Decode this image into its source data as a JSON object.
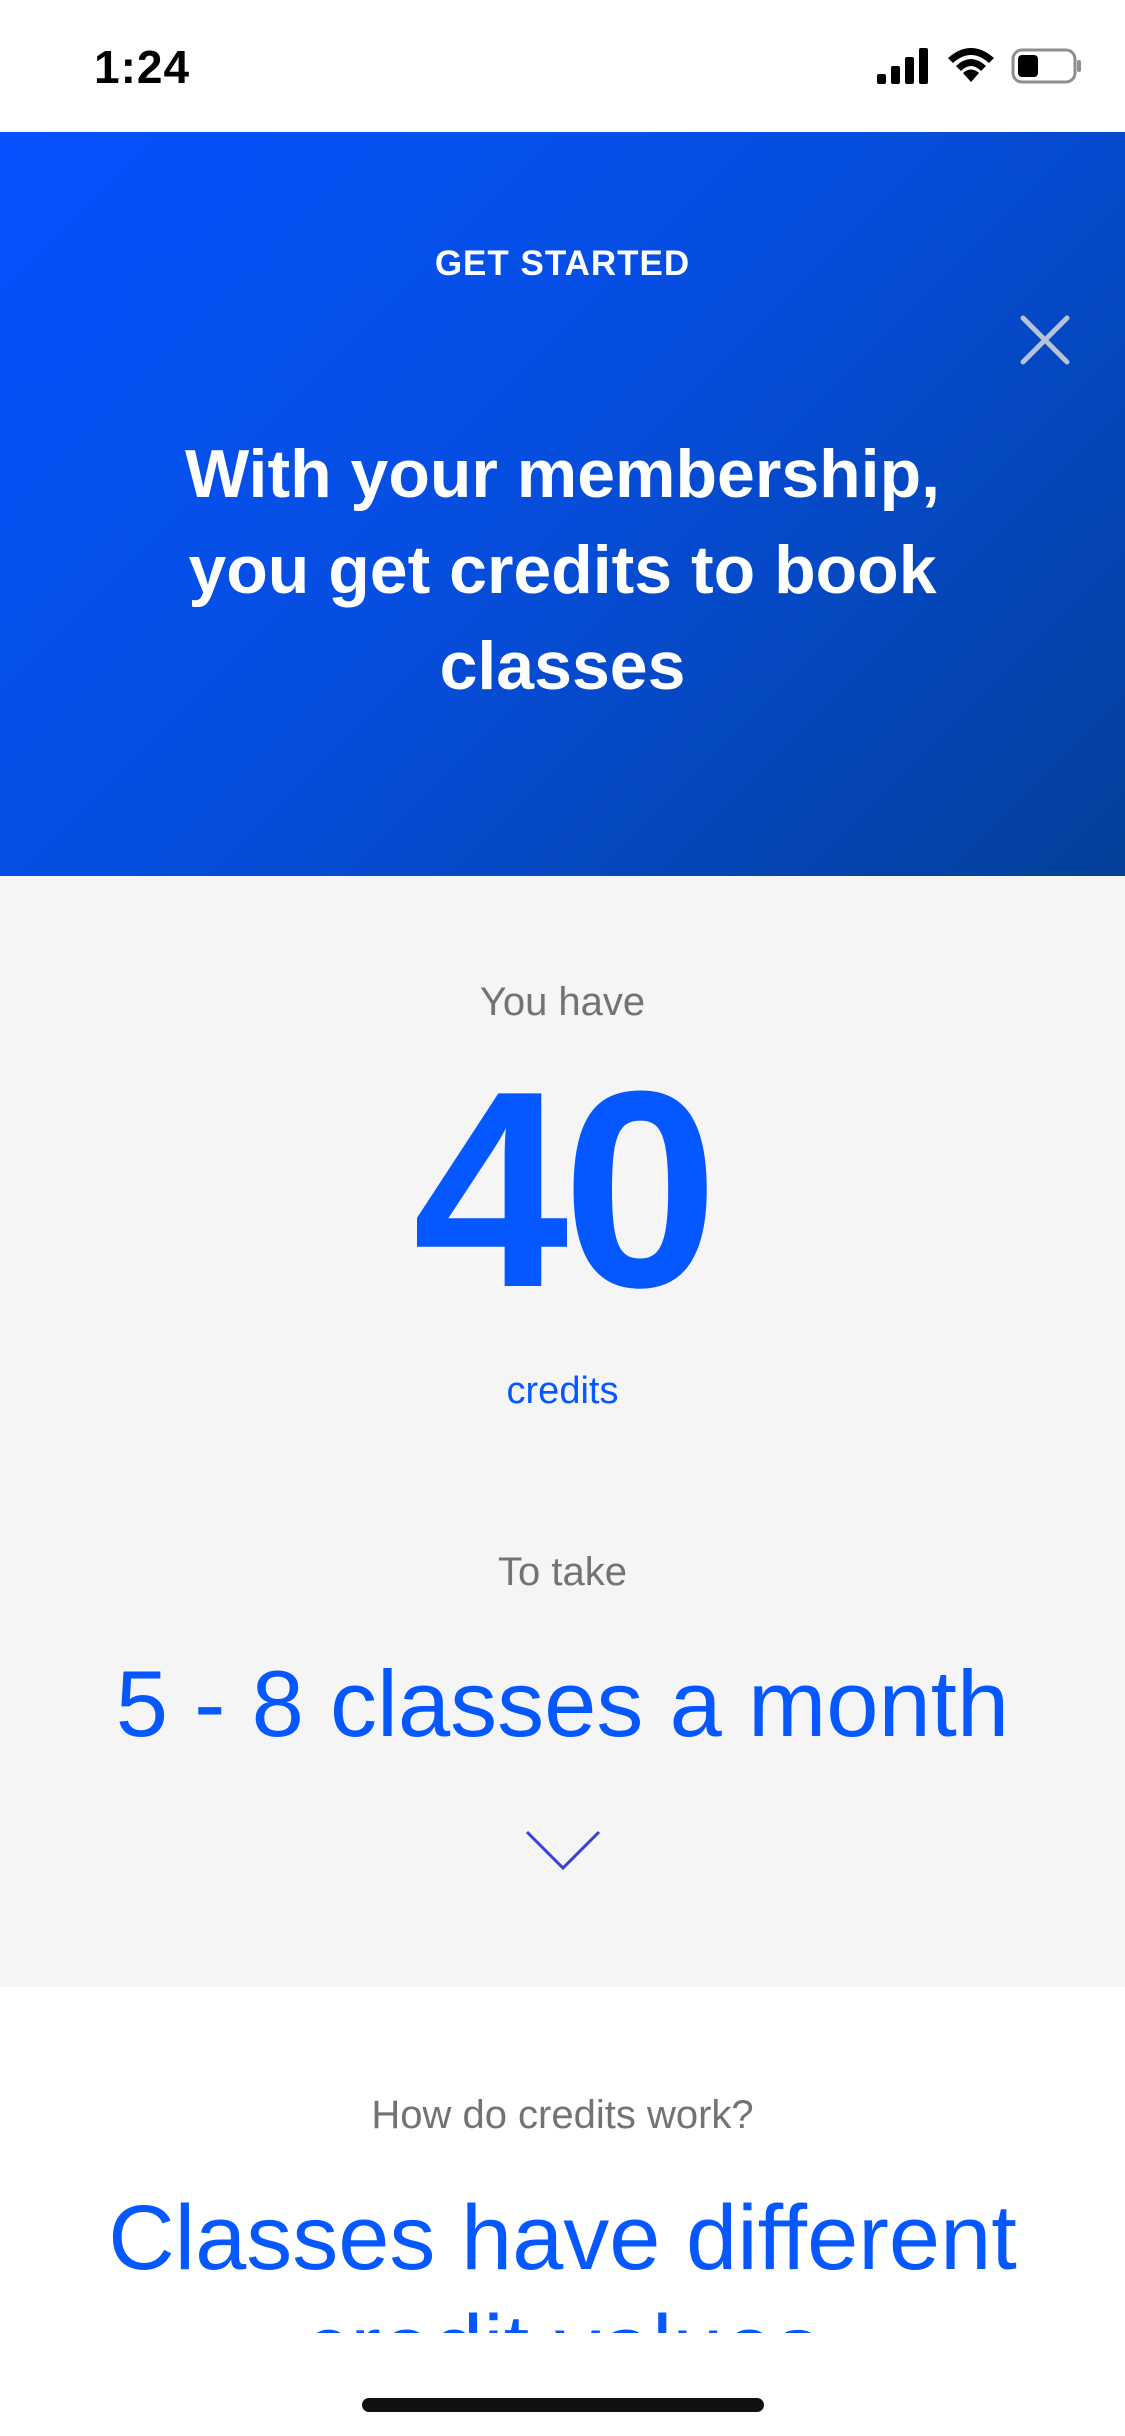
{
  "status_bar": {
    "time": "1:24"
  },
  "hero": {
    "kicker": "GET STARTED",
    "title": "With your membership, you get credits to book classes",
    "background_colors": [
      "#0552ff",
      "#03409a"
    ]
  },
  "credits": {
    "you_have_label": "You have",
    "amount": "40",
    "unit_label": "credits",
    "to_take_label": "To take",
    "classes_range": "5 - 8 classes a month"
  },
  "how_it_works": {
    "question": "How do credits work?",
    "heading": "Classes have different credit values"
  },
  "icons": {
    "close": "close-icon",
    "chevron": "chevron-down-icon",
    "signal": "signal-icon",
    "wifi": "wifi-icon",
    "battery": "battery-icon"
  },
  "colors": {
    "accent": "#0558ff",
    "muted_text": "#737373",
    "section_bg": "#f5f5f5"
  }
}
